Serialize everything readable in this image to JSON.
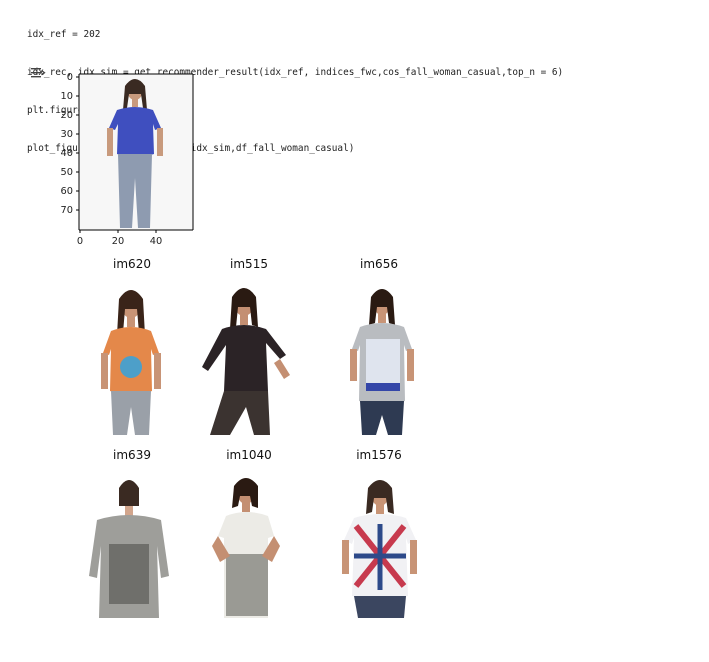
{
  "code": {
    "lines": [
      "idx_ref = 202",
      "idx_rec, idx_sim = get_recommender_result(idx_ref, indices_fwc,cos_fall_woman_casual,top_n = 6)",
      "plt.figure(figsize = (3,3))",
      "plot_figure(idx_ref,idx_rec, idx_sim,df_fall_woman_casual)"
    ]
  },
  "output": {
    "icon": "output-toggle-icon"
  },
  "reference_plot": {
    "y_ticks": [
      "0",
      "10",
      "20",
      "30",
      "40",
      "50",
      "60",
      "70"
    ],
    "x_ticks": [
      "0",
      "20",
      "40"
    ],
    "shirt_color": "#3f4fbf"
  },
  "recommendations": [
    {
      "label": "im620",
      "shirt_color": "#e4884a",
      "pants_color": "#9aa0a8"
    },
    {
      "label": "im515",
      "shirt_color": "#2b2326",
      "pants_color": "#3b3330"
    },
    {
      "label": "im656",
      "shirt_color": "#b9bcc0",
      "pants_color": "#2e3a52"
    },
    {
      "label": "im639",
      "shirt_color": "#9e9e9a",
      "pants_color": "#b8b8b4"
    },
    {
      "label": "im1040",
      "shirt_color": "#ecebe6",
      "pants_color": "#d8d8d2"
    },
    {
      "label": "im1576",
      "shirt_color": "#f1f1f4",
      "pants_color": "#3b4660"
    }
  ]
}
